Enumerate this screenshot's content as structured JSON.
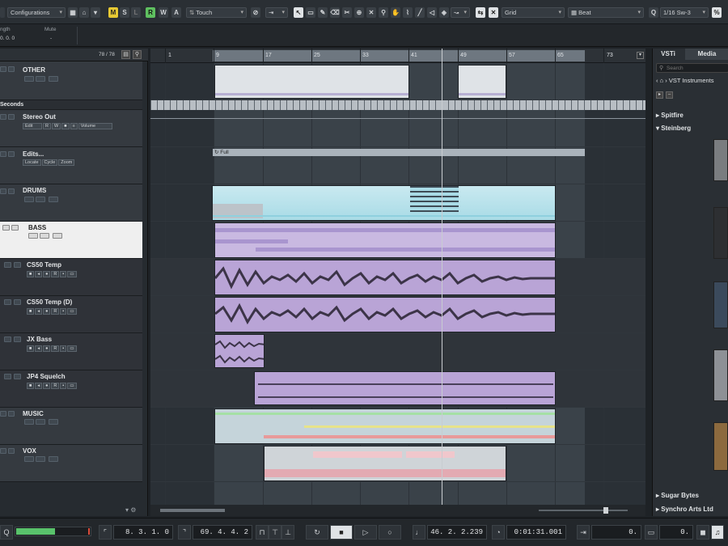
{
  "toolbar": {
    "configurations": "Configurations",
    "mode_buttons": [
      "M",
      "S",
      "L",
      "R",
      "W",
      "A"
    ],
    "automation_mode": "Touch",
    "grid_label": "Grid",
    "beat_label": "Beat",
    "quantize": "1/16 Sw-3"
  },
  "infoline": {
    "length_label": "ngth",
    "length_value": "0.  0.  0",
    "mute_label": "Mute",
    "mute_value": "-"
  },
  "project": {
    "counter": "78 / 78",
    "seconds_label": "Seconds"
  },
  "tracks": [
    {
      "name": "OTHER"
    },
    {
      "name": "Stereo Out",
      "buttons": [
        "Edit",
        "R",
        "W",
        "Volume"
      ]
    },
    {
      "name": "Edits...",
      "buttons": [
        "Locate",
        "Cycle",
        "Zoom"
      ]
    },
    {
      "name": "DRUMS"
    },
    {
      "name": "BASS"
    },
    {
      "name": "CS50 Temp"
    },
    {
      "name": "CS50 Temp (D)"
    },
    {
      "name": "JX Bass"
    },
    {
      "name": "JP4 Squelch"
    },
    {
      "name": "MUSIC"
    },
    {
      "name": "VOX"
    }
  ],
  "ruler": {
    "bars": [
      "1",
      "9",
      "17",
      "25",
      "33",
      "41",
      "49",
      "57",
      "65",
      "73"
    ]
  },
  "arrange": {
    "edits_part_label": "Full"
  },
  "transport": {
    "left_locator": "8.  3.  1.    0",
    "right_locator": "69.  4.  4.    2",
    "position_bars": "46.  2.  2.239",
    "position_time": "0:01:31.001",
    "tempo_field": "0.",
    "sync_field": "0."
  },
  "right_zone": {
    "tabs": [
      "VSTi",
      "Media"
    ],
    "search_placeholder": "Search",
    "breadcrumb": "VST Instruments",
    "vendors_top": [
      "Spitfire",
      "Steinberg"
    ],
    "vendors_bottom": [
      "Sugar Bytes",
      "Synchro Arts Ltd"
    ]
  },
  "colors": {
    "accent_yellow": "#e6c833",
    "mute_green": "#5fc060",
    "audio_purple": "#b9a4d6",
    "drums_cyan": "#a9dbe6",
    "range_highlight": "#6e7780"
  }
}
